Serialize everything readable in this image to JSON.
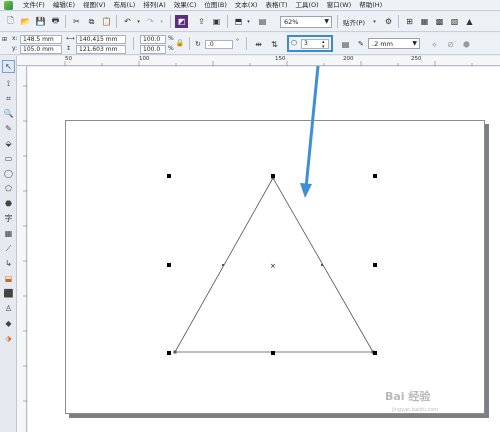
{
  "menubar": {
    "items": [
      "文件(F)",
      "编辑(E)",
      "视图(V)",
      "布局(L)",
      "排列(A)",
      "效果(C)",
      "位图(B)",
      "文本(X)",
      "表格(T)",
      "工具(O)",
      "窗口(W)",
      "帮助(H)"
    ]
  },
  "toolbar": {
    "zoom_value": "62%",
    "snap_label": "贴齐(P)"
  },
  "properties": {
    "x": "148.5 mm",
    "y": "105.0 mm",
    "width": "140.415 mm",
    "height": "121.603 mm",
    "scale_x": "100.0",
    "scale_y": "100.0",
    "percent_symbol": "%",
    "rotation": ".0",
    "degree_symbol": "°",
    "polygon_points": "3",
    "outline_width": ".2 mm"
  },
  "ruler_top": {
    "labels": [
      "50",
      "100",
      "150",
      "200",
      "250"
    ]
  },
  "watermark": {
    "text": "Bai 经验",
    "sub": "jingyan.baidu.com"
  },
  "colors": {
    "accent_blue": "#3d8fd6",
    "highlight_box": "#3b8bd2"
  },
  "icons": [
    "app-icon",
    "new-icon",
    "open-icon",
    "save-icon",
    "print-icon",
    "cut-icon",
    "copy-icon",
    "paste-icon",
    "undo-icon",
    "redo-icon",
    "import-icon",
    "export-icon",
    "launcher-icon",
    "options-icon"
  ]
}
